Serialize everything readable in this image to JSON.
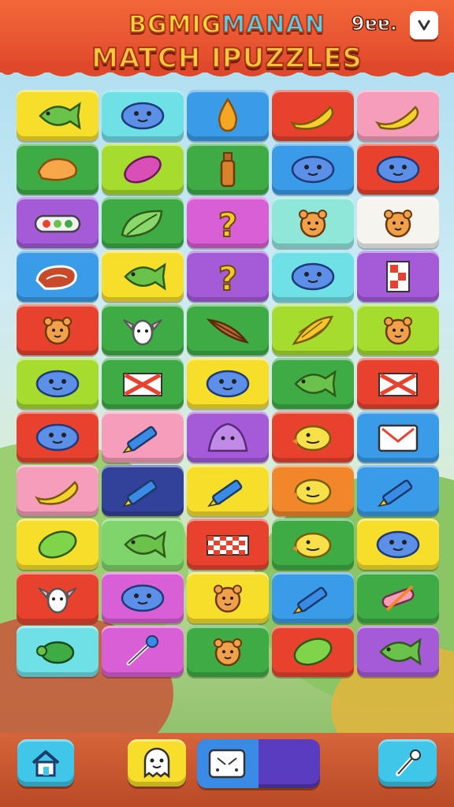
{
  "header": {
    "title_line1_a": "BGMIG",
    "title_line1_b": "MANAN",
    "title_line2": "MATCH IPUZZLES",
    "score": "9ɐɐ.",
    "pause_icon": "pause-icon"
  },
  "colors": {
    "yellow": "#f7de2a",
    "cyan": "#6fe0e6",
    "blue": "#3a9be8",
    "red": "#e8422f",
    "pink": "#f59dbb",
    "green": "#3fab45",
    "lime": "#a5dc2e",
    "purple": "#a55bd8",
    "orange": "#f2862b",
    "navy": "#32419a",
    "mint": "#8fe7d9",
    "white": "#f6f4ee",
    "lightgreen": "#7fd46b",
    "magenta": "#d95fd6"
  },
  "board": {
    "rows": [
      [
        {
          "bg": "yellow",
          "icon": "fish-icon"
        },
        {
          "bg": "cyan",
          "icon": "blob-icon"
        },
        {
          "bg": "blue",
          "icon": "drop-icon"
        },
        {
          "bg": "red",
          "icon": "banana-icon"
        },
        {
          "bg": "pink",
          "icon": "banana-icon"
        }
      ],
      [
        {
          "bg": "green",
          "icon": "mango-icon"
        },
        {
          "bg": "lime",
          "icon": "plum-icon"
        },
        {
          "bg": "green",
          "icon": "bottle-icon"
        },
        {
          "bg": "blue",
          "icon": "blob-icon"
        },
        {
          "bg": "red",
          "icon": "blob-icon"
        }
      ],
      [
        {
          "bg": "purple",
          "icon": "veggie-tray-icon"
        },
        {
          "bg": "green",
          "icon": "leaf-icon"
        },
        {
          "bg": "magenta",
          "icon": "question-icon"
        },
        {
          "bg": "mint",
          "icon": "bear-icon"
        },
        {
          "bg": "white",
          "icon": "bear-icon"
        }
      ],
      [
        {
          "bg": "blue",
          "icon": "steak-icon"
        },
        {
          "bg": "yellow",
          "icon": "fish-icon"
        },
        {
          "bg": "purple",
          "icon": "question-icon"
        },
        {
          "bg": "cyan",
          "icon": "blob-icon"
        },
        {
          "bg": "purple",
          "icon": "flag-icon"
        }
      ],
      [
        {
          "bg": "red",
          "icon": "bear-icon"
        },
        {
          "bg": "green",
          "icon": "goat-icon"
        },
        {
          "bg": "green",
          "icon": "feather-icon"
        },
        {
          "bg": "lime",
          "icon": "corn-icon"
        },
        {
          "bg": "lime",
          "icon": "bear-icon"
        }
      ],
      [
        {
          "bg": "lime",
          "icon": "blob-icon"
        },
        {
          "bg": "green",
          "icon": "cross-flag-icon"
        },
        {
          "bg": "yellow",
          "icon": "blob-icon"
        },
        {
          "bg": "green",
          "icon": "fish-icon"
        },
        {
          "bg": "red",
          "icon": "cross-flag-icon"
        }
      ],
      [
        {
          "bg": "red",
          "icon": "blob-icon"
        },
        {
          "bg": "pink",
          "icon": "crayon-icon"
        },
        {
          "bg": "purple",
          "icon": "slime-icon"
        },
        {
          "bg": "red",
          "icon": "chick-icon"
        },
        {
          "bg": "blue",
          "icon": "card-icon"
        }
      ],
      [
        {
          "bg": "pink",
          "icon": "banana-icon"
        },
        {
          "bg": "navy",
          "icon": "crayon-icon"
        },
        {
          "bg": "yellow",
          "icon": "crayon-icon"
        },
        {
          "bg": "orange",
          "icon": "chick-icon"
        },
        {
          "bg": "blue",
          "icon": "crayon-icon"
        }
      ],
      [
        {
          "bg": "yellow",
          "icon": "lime-icon"
        },
        {
          "bg": "lightgreen",
          "icon": "fish-icon"
        },
        {
          "bg": "red",
          "icon": "checker-icon"
        },
        {
          "bg": "green",
          "icon": "chick-icon"
        },
        {
          "bg": "yellow",
          "icon": "blob-icon"
        }
      ],
      [
        {
          "bg": "red",
          "icon": "goat-icon"
        },
        {
          "bg": "magenta",
          "icon": "blob-icon"
        },
        {
          "bg": "yellow",
          "icon": "bear-icon"
        },
        {
          "bg": "blue",
          "icon": "crayon-icon"
        },
        {
          "bg": "green",
          "icon": "candy-icon"
        }
      ],
      [
        {
          "bg": "cyan",
          "icon": "turtle-icon"
        },
        {
          "bg": "magenta",
          "icon": "wand-icon"
        },
        {
          "bg": "green",
          "icon": "bear-icon"
        },
        {
          "bg": "red",
          "icon": "lime-icon"
        },
        {
          "bg": "purple",
          "icon": "fish-icon"
        }
      ]
    ]
  },
  "bottom": {
    "home_icon": "home-icon",
    "ghost_icon": "ghost-icon",
    "board_icon": "board-icon",
    "hint_icon": "wand-icon",
    "progress": 0.5
  }
}
